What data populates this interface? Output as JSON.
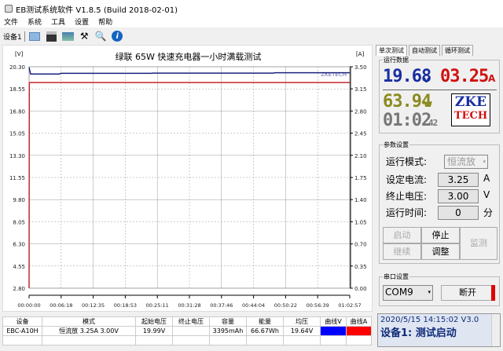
{
  "window": {
    "title": "EB测试系统软件 V1.8.5 (Build 2018-02-01)"
  },
  "menu": [
    "文件",
    "系统",
    "工具",
    "设置",
    "帮助"
  ],
  "toolbar": {
    "device": "设备1",
    "icons": [
      "folder-icon",
      "save-icon",
      "image-icon",
      "tools-icon",
      "search-icon",
      "info-icon"
    ]
  },
  "chart_data": {
    "type": "line",
    "title": "绿联 65W 快速充电器一小时满载测试",
    "ylabel_left": "[V]",
    "ylabel_right": "[A]",
    "watermark": "ZKETECH",
    "ylim_left": [
      2.8,
      20.3
    ],
    "ylim_right": [
      0.0,
      3.5
    ],
    "yticks_left": [
      "20.30",
      "18.55",
      "16.80",
      "15.05",
      "13.30",
      "11.55",
      "9.80",
      "8.05",
      "6.30",
      "4.55",
      "2.80"
    ],
    "yticks_right": [
      "3.50",
      "3.15",
      "2.80",
      "2.45",
      "2.10",
      "1.75",
      "1.40",
      "1.05",
      "0.70",
      "0.35",
      "0.00"
    ],
    "xticks": [
      "00:00:00",
      "00:06:18",
      "00:12:35",
      "00:18:53",
      "00:25:11",
      "00:31:28",
      "00:37:46",
      "00:44:04",
      "00:50:22",
      "00:56:39",
      "01:02:57"
    ],
    "xlim_minutes": [
      0,
      62.95
    ],
    "grid": true,
    "series": [
      {
        "name": "曲线V",
        "axis": "left",
        "color": "#1a237e",
        "points": [
          [
            0,
            20.25
          ],
          [
            0.3,
            19.72
          ],
          [
            6,
            19.72
          ],
          [
            6.2,
            19.78
          ],
          [
            24,
            19.78
          ],
          [
            24.2,
            19.8
          ],
          [
            48,
            19.8
          ],
          [
            48.2,
            19.83
          ],
          [
            62.95,
            19.83
          ]
        ]
      },
      {
        "name": "曲线A",
        "axis": "right",
        "color": "#c62828",
        "points": [
          [
            0,
            0
          ],
          [
            0.05,
            3.25
          ],
          [
            62.95,
            3.25
          ]
        ]
      }
    ]
  },
  "tabs": [
    "单次测试",
    "自动测试",
    "循环测试"
  ],
  "run_data": {
    "label": "运行数据",
    "voltage": "19.68",
    "voltage_unit": "v",
    "current": "03.25",
    "current_unit": "A",
    "power": "63.94",
    "power_unit": "w",
    "time": "01:02",
    "time_sec": "42",
    "logo_top": "ZKE",
    "logo_bottom": "TECH"
  },
  "params": {
    "label": "参数设置",
    "mode_label": "运行模式:",
    "mode": "恒流放",
    "current_label": "设定电流:",
    "current": "3.25",
    "current_unit": "A",
    "voltage_label": "终止电压:",
    "voltage": "3.00",
    "voltage_unit": "V",
    "time_label": "运行时间:",
    "time": "0",
    "time_unit": "分",
    "buttons": {
      "start": "启动",
      "stop": "停止",
      "monitor": "监测",
      "continue": "继续",
      "adjust": "调整"
    }
  },
  "serial": {
    "label": "串口设置",
    "port": "COM9",
    "disconnect": "断开",
    "status_color": "#e00000"
  },
  "table": {
    "headers": [
      "设备",
      "模式",
      "起始电压",
      "终止电压",
      "容量",
      "能量",
      "均压",
      "曲线V",
      "曲线A"
    ],
    "rows": [
      [
        "EBC-A10H",
        "恒流放 3.25A 3.00V",
        "19.99V",
        "",
        "3395mAh",
        "66.67Wh",
        "19.64V",
        "#0000ff",
        "#ff0000"
      ]
    ]
  },
  "status": {
    "line1": "2020/5/15 14:15:02  V3.0",
    "line2": "设备1: 测试启动"
  }
}
